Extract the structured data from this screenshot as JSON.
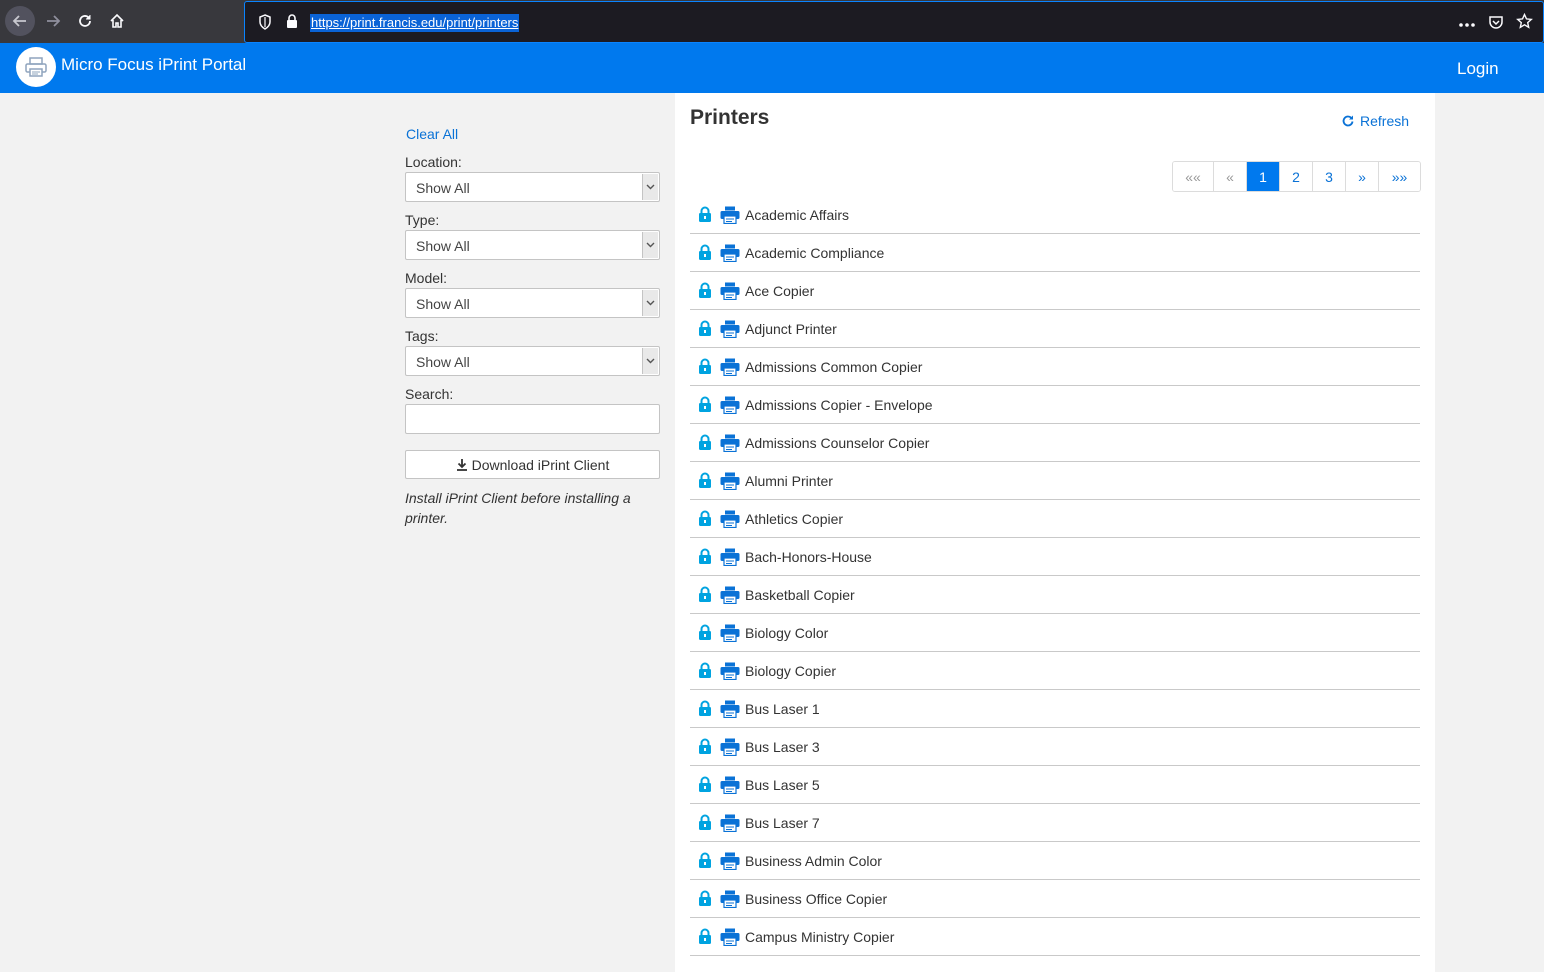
{
  "browser": {
    "url": "https://print.francis.edu/print/printers"
  },
  "header": {
    "title": "Micro Focus iPrint Portal",
    "login_label": "Login",
    "brand_color": "#0079ee"
  },
  "filters": {
    "clear_all_label": "Clear All",
    "location": {
      "label": "Location:",
      "value": "Show All"
    },
    "type": {
      "label": "Type:",
      "value": "Show All"
    },
    "model": {
      "label": "Model:",
      "value": "Show All"
    },
    "tags": {
      "label": "Tags:",
      "value": "Show All"
    },
    "search": {
      "label": "Search:",
      "value": ""
    },
    "download_label": "Download iPrint Client",
    "note": "Install iPrint Client before installing a printer."
  },
  "main": {
    "title": "Printers",
    "refresh_label": "Refresh",
    "pagination": [
      {
        "label": "««",
        "state": "disabled"
      },
      {
        "label": "«",
        "state": "disabled"
      },
      {
        "label": "1",
        "state": "active"
      },
      {
        "label": "2",
        "state": "normal"
      },
      {
        "label": "3",
        "state": "normal"
      },
      {
        "label": "»",
        "state": "normal"
      },
      {
        "label": "»»",
        "state": "normal"
      }
    ],
    "printers": [
      "Academic Affairs",
      "Academic Compliance",
      "Ace Copier",
      "Adjunct Printer",
      "Admissions Common Copier",
      "Admissions Copier - Envelope",
      "Admissions Counselor Copier",
      "Alumni Printer",
      "Athletics Copier",
      "Bach-Honors-House",
      "Basketball Copier",
      "Biology Color",
      "Biology Copier",
      "Bus Laser 1",
      "Bus Laser 3",
      "Bus Laser 5",
      "Bus Laser 7",
      "Business Admin Color",
      "Business Office Copier",
      "Campus Ministry Copier"
    ]
  }
}
